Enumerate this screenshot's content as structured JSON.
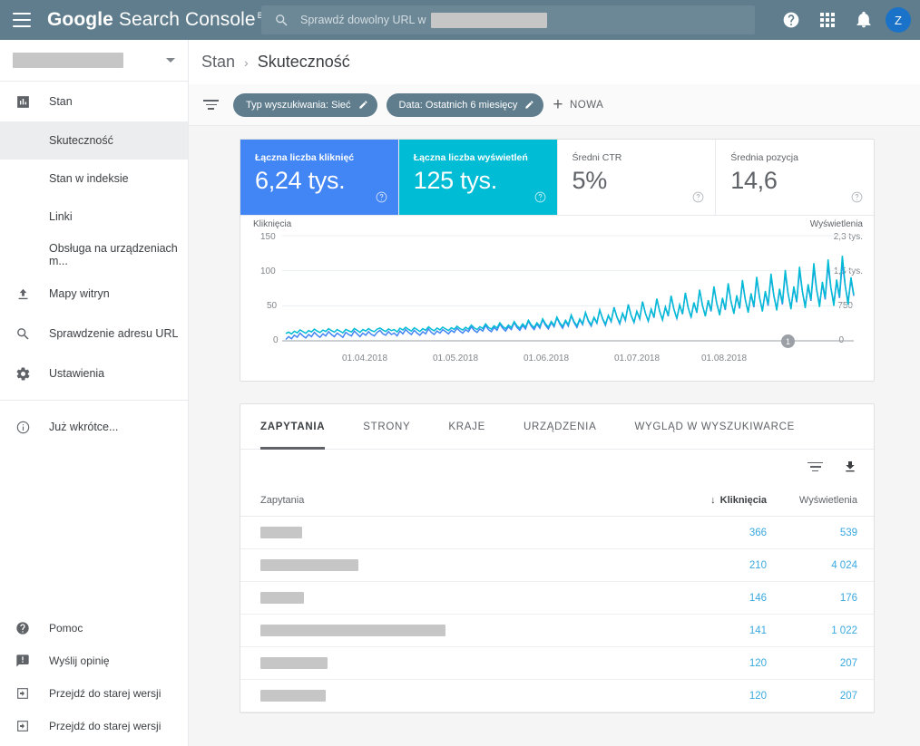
{
  "header": {
    "menu_icon": "hamburger-icon",
    "brand_bold": "Google",
    "brand_light": " Search Console",
    "beta": "BETA",
    "search_placeholder": "Sprawdź dowolny URL w",
    "help_icon": "help-icon",
    "apps_icon": "apps-grid-icon",
    "notifications_icon": "bell-icon",
    "avatar_initial": "Z"
  },
  "sidebar": {
    "property_selector": "",
    "items": [
      {
        "label": "Stan",
        "icon": "bar-chart-icon",
        "type": "parent"
      },
      {
        "label": "Skuteczność",
        "type": "sub",
        "active": true
      },
      {
        "label": "Stan w indeksie",
        "type": "sub",
        "active": false
      },
      {
        "label": "Linki",
        "type": "sub",
        "active": false
      },
      {
        "label": "Obsługa na urządzeniach m...",
        "type": "sub",
        "active": false
      },
      {
        "label": "Mapy witryn",
        "icon": "upload-icon",
        "type": "parent"
      },
      {
        "label": "Sprawdzenie adresu URL",
        "icon": "search-icon",
        "type": "parent"
      },
      {
        "label": "Ustawienia",
        "icon": "gear-icon",
        "type": "parent"
      },
      {
        "label": "Już wkrótce...",
        "icon": "info-icon",
        "type": "parent"
      }
    ],
    "bottom_items": [
      {
        "label": "Pomoc",
        "icon": "help-circle-icon"
      },
      {
        "label": "Wyślij opinię",
        "icon": "feedback-icon"
      },
      {
        "label": "Przejdź do starej wersji",
        "icon": "exit-icon"
      },
      {
        "label": "Przejdź do starej wersji",
        "icon": "exit-icon"
      }
    ]
  },
  "breadcrumb": {
    "parent": "Stan",
    "separator": "›",
    "current": "Skuteczność"
  },
  "filters": {
    "filter_icon": "filter-icon",
    "chips": [
      {
        "label": "Typ wyszukiwania: Sieć",
        "edit_icon": "pencil-icon"
      },
      {
        "label": "Data: Ostatnich 6 miesięcy",
        "edit_icon": "pencil-icon"
      }
    ],
    "new_filter_label": "NOWA",
    "plus": "+"
  },
  "metrics": [
    {
      "label": "Łączna liczba kliknięć",
      "value": "6,24 tys.",
      "color": "#4285f4",
      "selected": true
    },
    {
      "label": "Łączna liczba wyświetleń",
      "value": "125 tys.",
      "color": "#00bcd4",
      "selected": true
    },
    {
      "label": "Średni CTR",
      "value": "5%",
      "selected": false
    },
    {
      "label": "Średnia pozycja",
      "value": "14,6",
      "selected": false
    }
  ],
  "chart_data": {
    "type": "line",
    "title": "",
    "left_axis_label": "Kliknięcia",
    "right_axis_label": "Wyświetlenia",
    "left_ticks": [
      "150",
      "100",
      "50",
      "0"
    ],
    "right_ticks": [
      "2,3 tys.",
      "1,5 tys.",
      "750",
      "0"
    ],
    "left_ylim": [
      0,
      150
    ],
    "right_ylim": [
      0,
      2300
    ],
    "x_ticks": [
      "01.04.2018",
      "01.05.2018",
      "01.06.2018",
      "01.07.2018",
      "01.08.2018"
    ],
    "grid": true,
    "legend": "none",
    "annotation_marker": "1",
    "series": [
      {
        "name": "Kliknięcia",
        "color": "#4285f4",
        "axis": "left",
        "values": [
          2,
          6,
          3,
          8,
          5,
          11,
          7,
          4,
          9,
          6,
          12,
          8,
          5,
          10,
          7,
          13,
          9,
          6,
          11,
          8,
          5,
          12,
          9,
          7,
          14,
          10,
          6,
          11,
          8,
          13,
          9,
          7,
          12,
          15,
          10,
          8,
          13,
          9,
          11,
          7,
          14,
          10,
          16,
          12,
          9,
          15,
          11,
          8,
          13,
          10,
          17,
          12,
          9,
          14,
          11,
          16,
          13,
          10,
          15,
          12,
          18,
          14,
          11,
          16,
          13,
          20,
          15,
          12,
          17,
          14,
          22,
          16,
          13,
          19,
          15,
          24,
          18,
          14,
          20,
          16,
          26,
          19,
          15,
          22,
          17,
          28,
          21,
          16,
          24,
          18,
          30,
          22,
          17,
          26,
          20,
          33,
          24,
          18,
          28,
          21,
          36,
          26,
          19,
          30,
          23,
          40,
          28,
          21,
          33,
          25,
          44,
          31,
          22,
          36,
          27,
          48,
          34,
          24,
          39,
          29,
          52,
          36,
          26,
          42,
          31,
          56,
          39,
          28,
          45,
          33,
          60,
          42,
          30,
          48,
          35,
          64,
          45,
          32,
          51,
          38,
          68,
          47,
          34,
          54,
          40,
          72,
          50,
          36,
          57,
          42,
          76,
          53,
          38,
          60,
          44,
          80,
          56,
          40,
          63,
          46,
          84,
          58,
          42,
          66,
          48,
          88,
          61,
          44,
          69,
          50,
          92,
          64,
          46,
          72,
          52,
          96,
          67,
          48,
          75,
          55,
          100,
          70,
          50,
          78,
          57,
          104,
          72,
          52,
          81,
          59,
          108,
          75,
          54,
          84,
          61,
          112,
          78,
          56,
          87,
          64
        ]
      },
      {
        "name": "Wyświetlenia",
        "color": "#00bcd4",
        "axis": "right",
        "values": [
          160,
          190,
          150,
          210,
          175,
          240,
          200,
          165,
          225,
          195,
          255,
          215,
          180,
          235,
          205,
          265,
          225,
          190,
          245,
          210,
          175,
          250,
          220,
          195,
          270,
          230,
          185,
          245,
          215,
          265,
          225,
          200,
          255,
          280,
          235,
          205,
          260,
          225,
          245,
          195,
          275,
          235,
          295,
          250,
          215,
          285,
          245,
          205,
          265,
          230,
          305,
          255,
          220,
          280,
          240,
          300,
          260,
          225,
          285,
          250,
          320,
          270,
          235,
          295,
          255,
          345,
          285,
          245,
          310,
          270,
          370,
          295,
          255,
          330,
          280,
          395,
          315,
          265,
          345,
          290,
          420,
          330,
          275,
          370,
          300,
          450,
          350,
          290,
          395,
          315,
          480,
          370,
          300,
          425,
          335,
          520,
          395,
          315,
          450,
          355,
          565,
          420,
          330,
          480,
          375,
          620,
          450,
          350,
          515,
          400,
          675,
          490,
          365,
          555,
          430,
          730,
          525,
          390,
          600,
          460,
          790,
          560,
          410,
          645,
          490,
          855,
          600,
          435,
          690,
          520,
          920,
          645,
          460,
          740,
          555,
          985,
          690,
          485,
          790,
          590,
          1050,
          730,
          510,
          840,
          625,
          1120,
          775,
          535,
          890,
          660,
          1190,
          820,
          560,
          940,
          695,
          1260,
          865,
          590,
          995,
          730,
          1330,
          900,
          615,
          1040,
          760,
          1400,
          950,
          640,
          1090,
          795,
          1470,
          995,
          665,
          1140,
          830,
          1550,
          1040,
          690,
          1190,
          865,
          1620,
          1080,
          715,
          1240,
          900,
          1700,
          1120,
          740,
          1290,
          935,
          1780,
          1165,
          765,
          1340,
          970,
          1860,
          1210,
          790,
          1390,
          1010
        ]
      }
    ]
  },
  "table": {
    "tabs": [
      {
        "label": "ZAPYTANIA",
        "active": true
      },
      {
        "label": "STRONY",
        "active": false
      },
      {
        "label": "KRAJE",
        "active": false
      },
      {
        "label": "URZĄDZENIA",
        "active": false
      },
      {
        "label": "WYGLĄD W WYSZUKIWARCE",
        "active": false
      }
    ],
    "filter_icon": "filter-icon",
    "download_icon": "download-icon",
    "columns": [
      {
        "label": "Zapytania",
        "sorted": false
      },
      {
        "label": "Kliknięcia",
        "sorted": true,
        "sort_dir": "↓"
      },
      {
        "label": "Wyświetlenia",
        "sorted": false
      }
    ],
    "rows": [
      {
        "query": "",
        "query_width": 46,
        "clicks": "366",
        "impressions": "539"
      },
      {
        "query": "",
        "query_width": 108,
        "clicks": "210",
        "impressions": "4 024"
      },
      {
        "query": "",
        "query_width": 48,
        "clicks": "146",
        "impressions": "176"
      },
      {
        "query": "",
        "query_width": 204,
        "clicks": "141",
        "impressions": "1 022"
      },
      {
        "query": "",
        "query_width": 74,
        "clicks": "120",
        "impressions": "207"
      },
      {
        "query": "",
        "query_width": 72,
        "clicks": "120",
        "impressions": "207"
      }
    ]
  }
}
